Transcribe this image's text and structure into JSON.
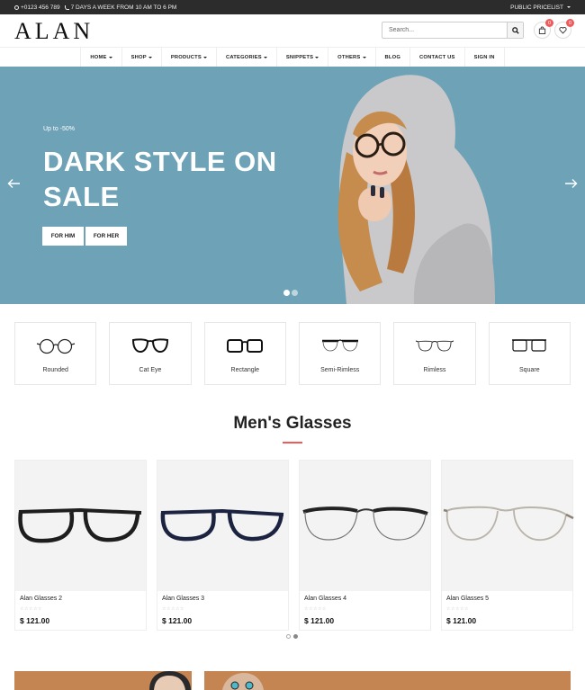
{
  "topbar": {
    "phone": "+0123 456 789",
    "hours": "7 DAYS A WEEK FROM 10 AM TO 6 PM",
    "pricelist": "PUBLIC PRICELIST"
  },
  "header": {
    "logo": "ALAN",
    "search_placeholder": "Search...",
    "cart_count": "0",
    "wishlist_count": "0"
  },
  "nav": [
    {
      "label": "HOME",
      "dropdown": true
    },
    {
      "label": "SHOP",
      "dropdown": true
    },
    {
      "label": "PRODUCTS",
      "dropdown": true
    },
    {
      "label": "CATEGORIES",
      "dropdown": true
    },
    {
      "label": "SNIPPETS",
      "dropdown": true
    },
    {
      "label": "OTHERS",
      "dropdown": true
    },
    {
      "label": "BLOG",
      "dropdown": false
    },
    {
      "label": "CONTACT US",
      "dropdown": false
    },
    {
      "label": "SIGN IN",
      "dropdown": false
    }
  ],
  "hero": {
    "tag": "Up to -50%",
    "title": "DARK STYLE ON SALE",
    "btn_him": "FOR HIM",
    "btn_her": "FOR HER",
    "bg_color": "#6ea2b6"
  },
  "shapes": [
    {
      "label": "Rounded",
      "icon": "round-glasses-icon"
    },
    {
      "label": "Cat Eye",
      "icon": "cat-eye-glasses-icon"
    },
    {
      "label": "Rectangle",
      "icon": "rectangle-glasses-icon"
    },
    {
      "label": "Semi-Rimless",
      "icon": "semi-rimless-glasses-icon"
    },
    {
      "label": "Rimless",
      "icon": "rimless-glasses-icon"
    },
    {
      "label": "Square",
      "icon": "square-glasses-icon"
    }
  ],
  "section": {
    "title": "Men's Glasses",
    "accent": "#ef5a5a"
  },
  "products": [
    {
      "name": "Alan Glasses 2",
      "price": "$ 121.00",
      "stars": "☆☆☆☆☆",
      "frame_color": "#1e1e1e"
    },
    {
      "name": "Alan Glasses 3",
      "price": "$ 121.00",
      "stars": "☆☆☆☆☆",
      "frame_color": "#1c2340"
    },
    {
      "name": "Alan Glasses 4",
      "price": "$ 121.00",
      "stars": "☆☆☆☆☆",
      "frame_color": "#222222"
    },
    {
      "name": "Alan Glasses 5",
      "price": "$ 121.00",
      "stars": "☆☆☆☆☆",
      "frame_color": "#b9b4aa"
    }
  ]
}
